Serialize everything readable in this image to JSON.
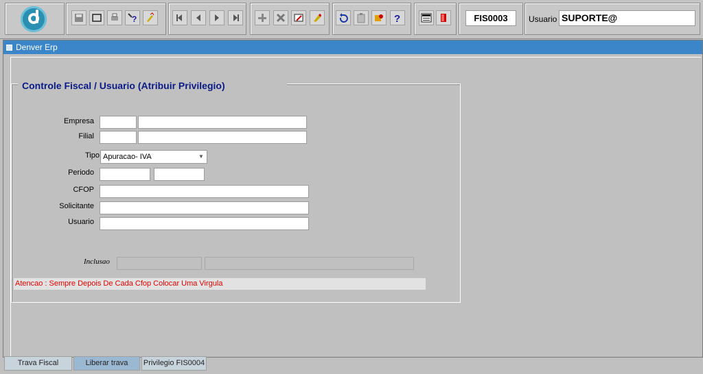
{
  "toolbar": {
    "form_code": "FIS0003",
    "user_label": "Usuario",
    "user_value": "SUPORTE@"
  },
  "window": {
    "title": "Denver Erp"
  },
  "form": {
    "frame_title": "Controle Fiscal / Usuario (Atribuir Privilegio)",
    "labels": {
      "empresa": "Empresa",
      "filial": "Filial",
      "tipo": "Tipo",
      "periodo": "Periodo",
      "cfop": "CFOP",
      "solicitante": "Solicitante",
      "usuario": "Usuario",
      "inclusao": "Inclusao"
    },
    "tipo_value": "Apuracao- IVA",
    "warning": "Atencao : Sempre Depois De Cada Cfop Colocar Uma Virgula"
  },
  "tabs": [
    {
      "label": "Trava Fiscal"
    },
    {
      "label": "Liberar trava"
    },
    {
      "label": "Privilegio FIS0004"
    }
  ],
  "colors": {
    "titlebar": "#3a86c8",
    "frame_title": "#0a1a86",
    "warning_text": "#e00000",
    "active_tab": "#9ab8d2"
  }
}
